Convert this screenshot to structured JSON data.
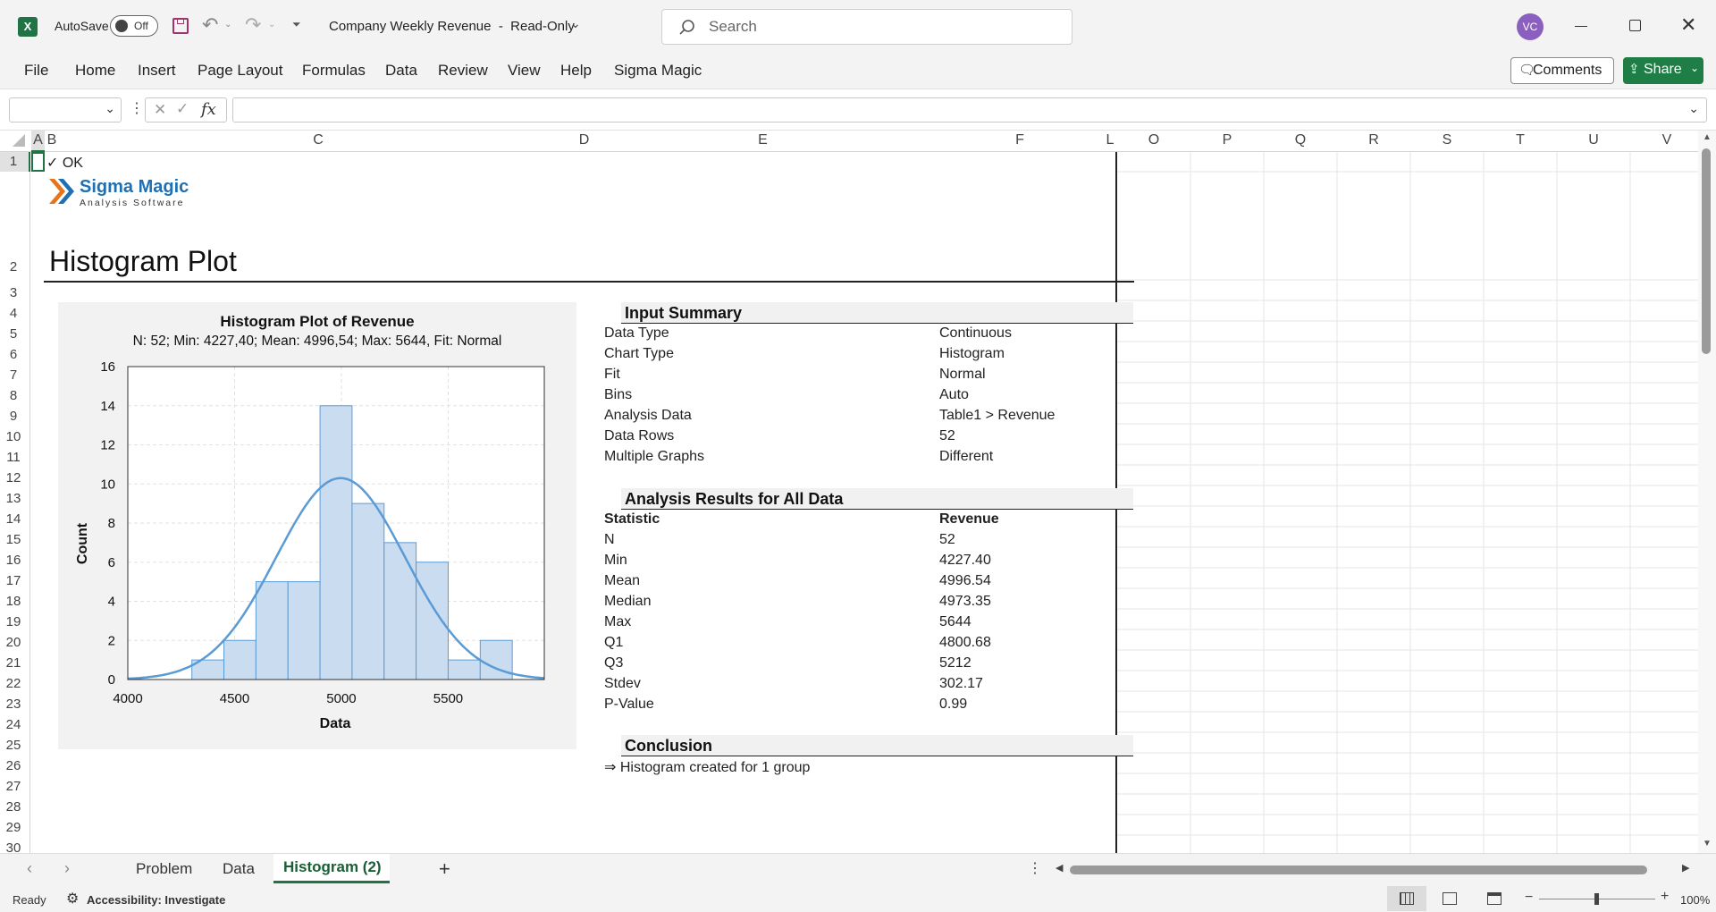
{
  "titlebar": {
    "autosave_label": "AutoSave",
    "autosave_state": "Off",
    "doc_title": "Company Weekly Revenue  -  Read-Only",
    "search_placeholder": "Search",
    "avatar_initials": "VC"
  },
  "menu": {
    "items": [
      "File",
      "Home",
      "Insert",
      "Page Layout",
      "Formulas",
      "Data",
      "Review",
      "View",
      "Help",
      "Sigma Magic"
    ],
    "comments_label": "Comments",
    "share_label": "Share"
  },
  "formula_bar": {
    "name_box": "",
    "fx_label": "fx",
    "formula": ""
  },
  "columns": [
    "A",
    "B",
    "C",
    "D",
    "E",
    "F",
    "L",
    "O",
    "P",
    "Q",
    "R",
    "S",
    "T",
    "U",
    "V"
  ],
  "rows": [
    "1",
    "2",
    "3",
    "4",
    "5",
    "6",
    "7",
    "8",
    "9",
    "10",
    "11",
    "12",
    "13",
    "14",
    "15",
    "16",
    "17",
    "18",
    "19",
    "20",
    "21",
    "22",
    "23",
    "24",
    "25",
    "26",
    "27",
    "28",
    "29",
    "30"
  ],
  "report": {
    "ok_text": "✓ OK",
    "logo_title": "Sigma Magic",
    "logo_subtitle": "Analysis Software",
    "heading": "Histogram Plot",
    "input_summary_title": "Input Summary",
    "input_summary": [
      {
        "label": "Data Type",
        "value": "Continuous"
      },
      {
        "label": "Chart Type",
        "value": "Histogram"
      },
      {
        "label": "Fit",
        "value": "Normal"
      },
      {
        "label": "Bins",
        "value": "Auto"
      },
      {
        "label": "Analysis Data",
        "value": "Table1 > Revenue"
      },
      {
        "label": "Data Rows",
        "value": "52"
      },
      {
        "label": "Multiple Graphs",
        "value": "Different"
      }
    ],
    "results_title": "Analysis Results for All Data",
    "results_header": {
      "label": "Statistic",
      "value": "Revenue"
    },
    "results": [
      {
        "label": "N",
        "value": "52"
      },
      {
        "label": "Min",
        "value": "4227.40"
      },
      {
        "label": "Mean",
        "value": "4996.54"
      },
      {
        "label": "Median",
        "value": "4973.35"
      },
      {
        "label": "Max",
        "value": "5644"
      },
      {
        "label": "Q1",
        "value": "4800.68"
      },
      {
        "label": "Q3",
        "value": "5212"
      },
      {
        "label": "Stdev",
        "value": "302.17"
      },
      {
        "label": "P-Value",
        "value": "0.99"
      }
    ],
    "conclusion_title": "Conclusion",
    "conclusion_text": "⇒ Histogram created for 1 group"
  },
  "chart_data": {
    "type": "bar",
    "title": "Histogram Plot of Revenue",
    "subtitle": "N: 52; Min: 4227,40; Mean: 4996,54; Max: 5644, Fit: Normal",
    "xlabel": "Data",
    "ylabel": "Count",
    "xlim": [
      4000,
      5950
    ],
    "ylim": [
      0,
      16
    ],
    "xticks": [
      4000,
      4500,
      5000,
      5500
    ],
    "yticks": [
      0,
      2,
      4,
      6,
      8,
      10,
      12,
      14,
      16
    ],
    "bins": [
      {
        "start": 4300,
        "end": 4450,
        "count": 1
      },
      {
        "start": 4450,
        "end": 4600,
        "count": 2
      },
      {
        "start": 4600,
        "end": 4750,
        "count": 5
      },
      {
        "start": 4750,
        "end": 4900,
        "count": 5
      },
      {
        "start": 4900,
        "end": 5050,
        "count": 14
      },
      {
        "start": 5050,
        "end": 5200,
        "count": 9
      },
      {
        "start": 5200,
        "end": 5350,
        "count": 7
      },
      {
        "start": 5350,
        "end": 5500,
        "count": 6
      },
      {
        "start": 5500,
        "end": 5650,
        "count": 1
      },
      {
        "start": 5650,
        "end": 5800,
        "count": 2
      }
    ],
    "fit": {
      "type": "normal",
      "mean": 4996.54,
      "stdev": 302.17,
      "n": 52,
      "bin_width": 150
    },
    "grid": true,
    "colors": {
      "bar_fill": "#c9dcf0",
      "bar_stroke": "#5b9bd5",
      "fit_line": "#5b9bd5"
    }
  },
  "tabs": {
    "sheets": [
      "Problem",
      "Data",
      "Histogram (2)"
    ],
    "active": "Histogram (2)"
  },
  "status": {
    "ready": "Ready",
    "accessibility": "Accessibility: Investigate",
    "zoom": "100%"
  },
  "colors": {
    "excel_green": "#217346",
    "share_green": "#1e7e45",
    "accent_blue": "#1f6fb5",
    "logo_orange": "#e8731a",
    "avatar": "#8b5fbf"
  }
}
